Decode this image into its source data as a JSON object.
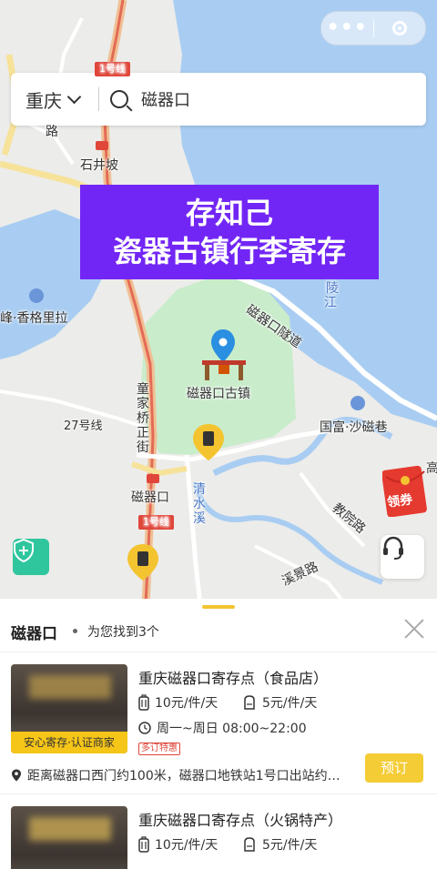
{
  "capsule": {
    "more": "•••"
  },
  "search": {
    "city": "重庆",
    "query": "磁器口"
  },
  "banner": {
    "line1": "存知己",
    "line2": "瓷器古镇行李寄存"
  },
  "map_labels": {
    "line1_top": "1号线",
    "road_top": "路",
    "shijingpo": "石井坡",
    "shangrila": "峰·香格里拉",
    "jialing": "陵",
    "jiang": "江",
    "tunnel": "磁器口隧道",
    "old_town": "磁器口古镇",
    "tongjia": "童家桥正街",
    "line27": "27号线",
    "guofu": "国富·沙磁巷",
    "ciqikou": "磁器口",
    "qingshuixi": "清水溪",
    "line1_bottom": "1号线",
    "jiaoyuan": "教院路",
    "xijing": "溪景路",
    "gao": "高",
    "coupon": "领券"
  },
  "results": {
    "title": "磁器口",
    "summary": "为您找到3个"
  },
  "stores": [
    {
      "name": "重庆磁器口寄存点（食品店）",
      "price_large": "10元/件/天",
      "price_small": "5元/件/天",
      "hours": "周一~周日 08:00~22:00",
      "promo": "多订特惠",
      "tag": "安心寄存·认证商家",
      "address": "距离磁器口西门约100米，磁器口地铁站1号口出站约…",
      "book": "预订"
    },
    {
      "name": "重庆磁器口寄存点（火锅特产）",
      "price_large": "10元/件/天",
      "price_small": "5元/件/天"
    }
  ],
  "colors": {
    "banner": "#7226f5",
    "accent_yellow": "#f4cc36",
    "map_water": "#a9cdf2",
    "map_park": "#c9eccb",
    "safe_green": "#2fc69d"
  }
}
